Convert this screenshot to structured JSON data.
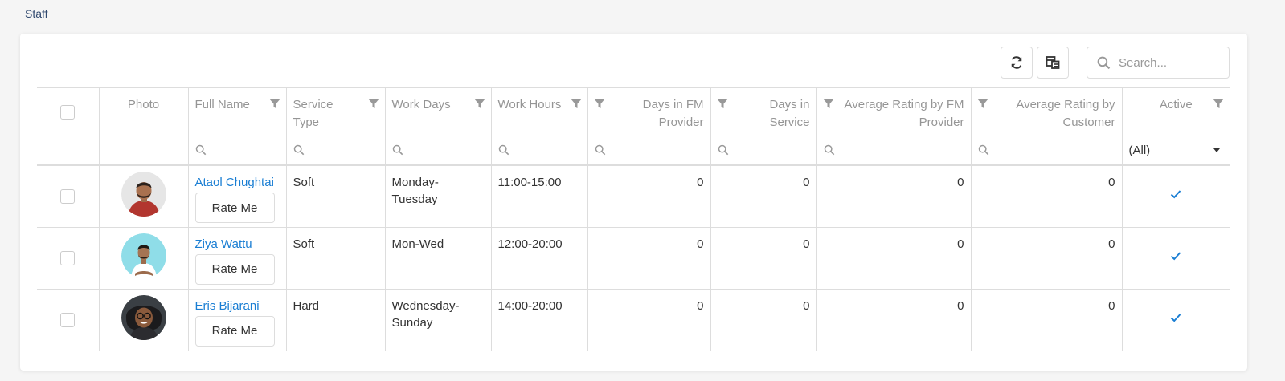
{
  "page": {
    "title": "Staff"
  },
  "toolbar": {
    "refresh_icon": "refresh-icon",
    "column_chooser_icon": "column-chooser-icon",
    "search_placeholder": "Search...",
    "search_value": ""
  },
  "grid": {
    "headers": {
      "photo": "Photo",
      "full_name": "Full Name",
      "service_type": "Service Type",
      "work_days": "Work Days",
      "work_hours": "Work Hours",
      "days_in_fm_provider": "Days in FM Provider",
      "days_in_service": "Days in Service",
      "avg_rating_fm": "Average Rating by FM Provider",
      "avg_rating_customer": "Average Rating by Customer",
      "active": "Active"
    },
    "active_filter_value": "(All)",
    "rate_label": "Rate Me",
    "rows": [
      {
        "name": "Ataol Chughtai",
        "service_type": "Soft",
        "work_days": "Monday-Tuesday",
        "work_hours": "11:00-15:00",
        "days_fm": "0",
        "days_service": "0",
        "rating_fm": "0",
        "rating_customer": "0",
        "active": true
      },
      {
        "name": "Ziya Wattu",
        "service_type": "Soft",
        "work_days": "Mon-Wed",
        "work_hours": "12:00-20:00",
        "days_fm": "0",
        "days_service": "0",
        "rating_fm": "0",
        "rating_customer": "0",
        "active": true
      },
      {
        "name": "Eris Bijarani",
        "service_type": "Hard",
        "work_days": "Wednesday-Sunday",
        "work_hours": "14:00-20:00",
        "days_fm": "0",
        "days_service": "0",
        "rating_fm": "0",
        "rating_customer": "0",
        "active": true
      }
    ]
  },
  "colors": {
    "accent": "#1a7ed3",
    "title": "#30496f",
    "header_text": "#959595",
    "border": "#dddddd"
  }
}
